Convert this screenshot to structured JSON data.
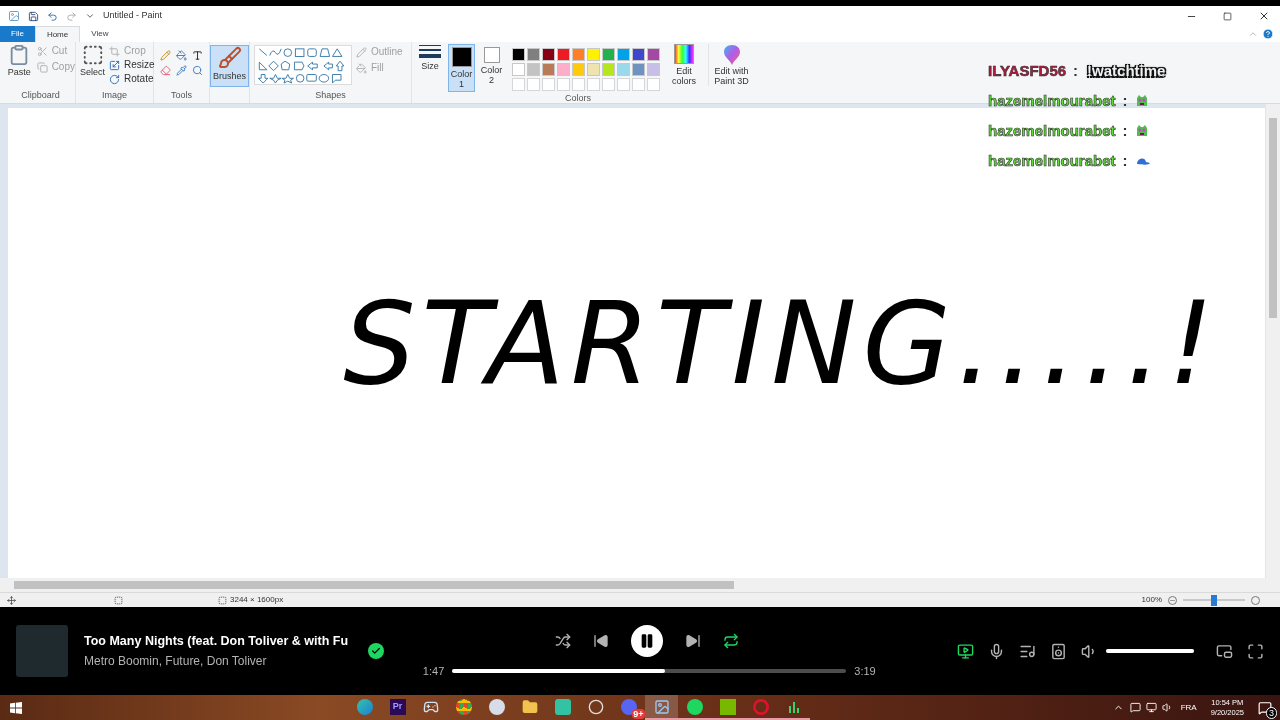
{
  "window": {
    "title": "Untitled - Paint"
  },
  "ribbon_tabs": [
    {
      "label": "File",
      "kind": "file",
      "selected": false
    },
    {
      "label": "Home",
      "kind": "tab",
      "selected": true
    },
    {
      "label": "View",
      "kind": "tab",
      "selected": false
    }
  ],
  "clipboard": {
    "title": "Clipboard",
    "paste": "Paste",
    "cut": {
      "label": "Cut",
      "disabled": true
    },
    "copy": {
      "label": "Copy",
      "disabled": true
    }
  },
  "image": {
    "title": "Image",
    "select": "Select",
    "crop": {
      "label": "Crop",
      "disabled": true
    },
    "resize": {
      "label": "Resize",
      "disabled": false
    },
    "rotate": {
      "label": "Rotate",
      "disabled": false
    }
  },
  "tools": {
    "title": "Tools"
  },
  "brushes": {
    "label": "Brushes",
    "selected": true
  },
  "shapes": {
    "title": "Shapes",
    "outline": {
      "label": "Outline",
      "disabled": true
    },
    "fill": {
      "label": "Fill",
      "disabled": true
    }
  },
  "size": {
    "label": "Size"
  },
  "color_slots": [
    {
      "label": "Color 1",
      "color": "#000000",
      "selected": true
    },
    {
      "label": "Color 2",
      "color": "#ffffff",
      "selected": false
    }
  ],
  "palette": [
    {
      "color": "#000000"
    },
    {
      "color": "#7f7f7f"
    },
    {
      "color": "#880015"
    },
    {
      "color": "#ed1c24"
    },
    {
      "color": "#ff7f27"
    },
    {
      "color": "#fff200"
    },
    {
      "color": "#22b14c"
    },
    {
      "color": "#00a2e8"
    },
    {
      "color": "#3f48cc"
    },
    {
      "color": "#a349a4"
    },
    {
      "color": "#ffffff"
    },
    {
      "color": "#c3c3c3"
    },
    {
      "color": "#b97a57"
    },
    {
      "color": "#ffaec9"
    },
    {
      "color": "#ffc90e"
    },
    {
      "color": "#efe4b0"
    },
    {
      "color": "#b5e61d"
    },
    {
      "color": "#99d9ea"
    },
    {
      "color": "#7092be"
    },
    {
      "color": "#c8bfe7"
    }
  ],
  "colors_title": "Colors",
  "edit_colors": "Edit colors",
  "paint3d": "Edit with Paint 3D",
  "canvas_text": "STARTING.....!",
  "chat": [
    {
      "user": "ILYASFD56",
      "color": "#b5173f",
      "kind": "text",
      "text": "!watchtime"
    },
    {
      "user": "hazemelmourabet",
      "color": "#5fdc3a",
      "kind": "creature"
    },
    {
      "user": "hazemelmourabet",
      "color": "#5fdc3a",
      "kind": "creature"
    },
    {
      "user": "hazemelmourabet",
      "color": "#5fdc3a",
      "kind": "cap"
    }
  ],
  "chat_separator": ":",
  "status_bar": {
    "dimensions": "3244 × 1600px",
    "zoom": "100%",
    "zoom_level": {
      "level": 0.5
    }
  },
  "player": {
    "title": "Too Many Nights (feat. Don Toliver & with Fu",
    "artist": "Metro Boomin, Future, Don Toliver",
    "liked": true,
    "shuffle": false,
    "playing": true,
    "repeat": true,
    "elapsed": "1:47",
    "duration": "3:19",
    "progress": {
      "level": 0.54
    },
    "now_playing_view": true,
    "volume": {
      "level": 1
    }
  },
  "taskbar": {
    "apps": [
      {
        "kind": "edge",
        "selected": false,
        "running": false
      },
      {
        "kind": "premiere",
        "label": "Pr",
        "selected": false,
        "running": false
      },
      {
        "kind": "steam",
        "selected": false,
        "running": false
      },
      {
        "kind": "chrome",
        "selected": false,
        "running": false
      },
      {
        "kind": "paint3d",
        "selected": false,
        "running": false
      },
      {
        "kind": "folder",
        "selected": false,
        "running": false
      },
      {
        "kind": "streamlabs",
        "selected": false,
        "running": false
      },
      {
        "kind": "obs",
        "selected": false,
        "running": false
      },
      {
        "kind": "discord",
        "badge": "9+",
        "selected": false,
        "running": false
      },
      {
        "kind": "paint",
        "selected": true,
        "running": true
      },
      {
        "kind": "spotify",
        "selected": false,
        "running": true
      },
      {
        "kind": "nvidia",
        "selected": false,
        "running": true
      },
      {
        "kind": "opera",
        "selected": false,
        "running": true
      },
      {
        "kind": "meter",
        "selected": false,
        "running": true
      }
    ],
    "language": "FRA",
    "time": "10:54 PM",
    "date": "9/20/2025",
    "notifications": "3"
  }
}
